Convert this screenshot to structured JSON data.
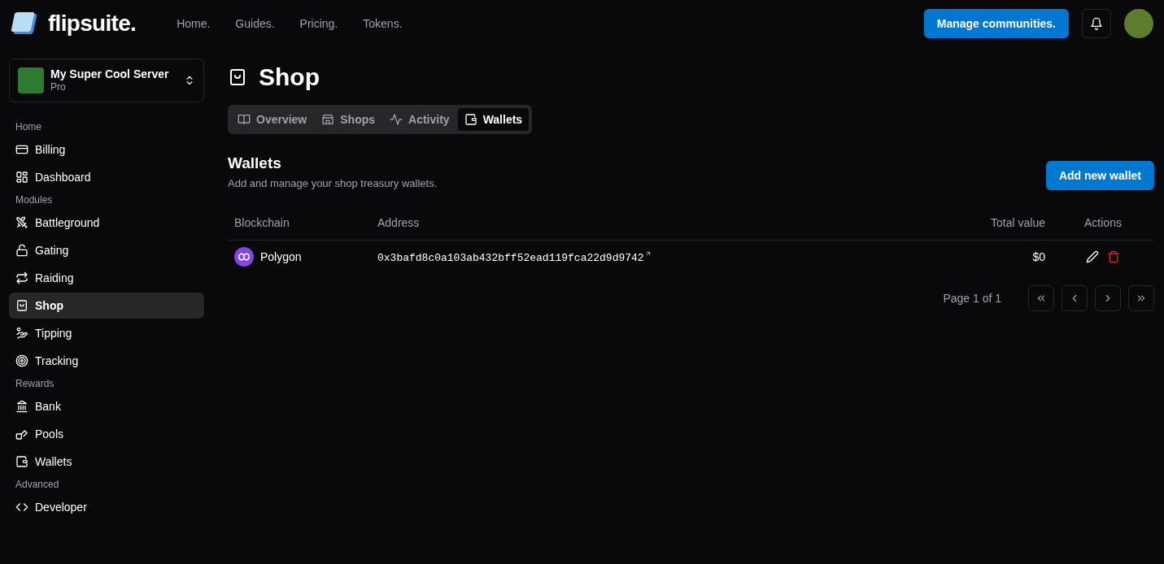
{
  "header": {
    "brand": "flipsuite.",
    "nav": [
      "Home.",
      "Guides.",
      "Pricing.",
      "Tokens."
    ],
    "manage_button": "Manage communities."
  },
  "server": {
    "name": "My Super Cool Server",
    "plan": "Pro"
  },
  "sidebar": [
    {
      "label": "Home",
      "items": [
        {
          "label": "Billing",
          "selected": false
        },
        {
          "label": "Dashboard",
          "selected": false
        }
      ]
    },
    {
      "label": "Modules",
      "items": [
        {
          "label": "Battleground",
          "selected": false
        },
        {
          "label": "Gating",
          "selected": false
        },
        {
          "label": "Raiding",
          "selected": false
        },
        {
          "label": "Shop",
          "selected": true
        },
        {
          "label": "Tipping",
          "selected": false
        },
        {
          "label": "Tracking",
          "selected": false
        }
      ]
    },
    {
      "label": "Rewards",
      "items": [
        {
          "label": "Bank",
          "selected": false
        },
        {
          "label": "Pools",
          "selected": false
        },
        {
          "label": "Wallets",
          "selected": false
        }
      ]
    },
    {
      "label": "Advanced",
      "items": [
        {
          "label": "Developer",
          "selected": false
        }
      ]
    }
  ],
  "page_title": "Shop",
  "tabs": [
    {
      "label": "Overview",
      "selected": false
    },
    {
      "label": "Shops",
      "selected": false
    },
    {
      "label": "Activity",
      "selected": false
    },
    {
      "label": "Wallets",
      "selected": true
    }
  ],
  "section": {
    "title": "Wallets",
    "subtitle": "Add and manage your shop treasury wallets.",
    "add_button": "Add new wallet"
  },
  "table": {
    "columns": [
      "Blockchain",
      "Address",
      "Total value",
      "Actions"
    ],
    "rows": [
      {
        "blockchain": "Polygon",
        "address": "0x3bafd8c0a103ab432bff52ead119fca22d9d9742",
        "total_value": "$0"
      }
    ]
  },
  "pagination": {
    "label": "Page 1 of 1"
  }
}
